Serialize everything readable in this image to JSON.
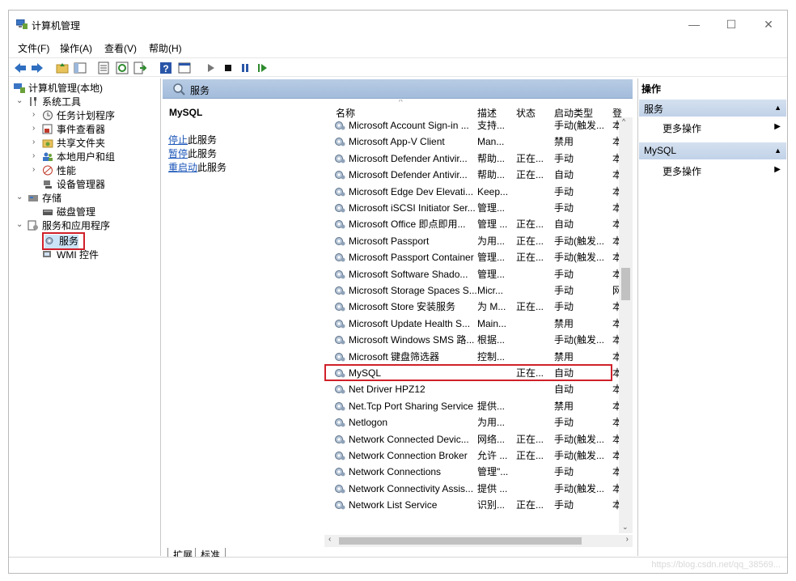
{
  "window": {
    "title": "计算机管理",
    "controls": {
      "minimize": "—",
      "maximize": "☐",
      "close": "✕"
    }
  },
  "menubar": {
    "items": [
      "文件(F)",
      "操作(A)",
      "查看(V)",
      "帮助(H)"
    ]
  },
  "toolbar": {
    "icons": [
      "back-icon",
      "forward-icon",
      "folder-up-icon",
      "show-tree-icon",
      "properties-icon",
      "refresh-icon",
      "export-icon",
      "help-icon",
      "console-icon",
      "play-icon",
      "stop-icon",
      "pause-icon",
      "resume-icon"
    ]
  },
  "tree": {
    "root": "计算机管理(本地)",
    "system_tools": "系统工具",
    "task_scheduler": "任务计划程序",
    "event_viewer": "事件查看器",
    "shared_folders": "共享文件夹",
    "local_users": "本地用户和组",
    "performance": "性能",
    "device_manager": "设备管理器",
    "storage": "存储",
    "disk_mgmt": "磁盘管理",
    "services_apps": "服务和应用程序",
    "services": "服务",
    "wmi": "WMI 控件"
  },
  "center": {
    "header": "服务",
    "selected_service": "MySQL",
    "actions": [
      {
        "link": "停止",
        "rest": "此服务"
      },
      {
        "link": "暂停",
        "rest": "此服务"
      },
      {
        "link": "重启动",
        "rest": "此服务"
      }
    ],
    "columns": {
      "name": "名称",
      "desc": "描述",
      "status": "状态",
      "startup": "启动类型",
      "logon": "登"
    },
    "rows": [
      {
        "name": "Microsoft Account Sign-in ...",
        "desc": "支持...",
        "status": "",
        "startup": "手动(触发...",
        "logon": "本"
      },
      {
        "name": "Microsoft App-V Client",
        "desc": "Man...",
        "status": "",
        "startup": "禁用",
        "logon": "本"
      },
      {
        "name": "Microsoft Defender Antivir...",
        "desc": "帮助...",
        "status": "正在...",
        "startup": "手动",
        "logon": "本"
      },
      {
        "name": "Microsoft Defender Antivir...",
        "desc": "帮助...",
        "status": "正在...",
        "startup": "自动",
        "logon": "本"
      },
      {
        "name": "Microsoft Edge Dev Elevati...",
        "desc": "Keep...",
        "status": "",
        "startup": "手动",
        "logon": "本"
      },
      {
        "name": "Microsoft iSCSI Initiator Ser...",
        "desc": "管理...",
        "status": "",
        "startup": "手动",
        "logon": "本"
      },
      {
        "name": "Microsoft Office 即点即用...",
        "desc": "管理 ...",
        "status": "正在...",
        "startup": "自动",
        "logon": "本"
      },
      {
        "name": "Microsoft Passport",
        "desc": "为用...",
        "status": "正在...",
        "startup": "手动(触发...",
        "logon": "本"
      },
      {
        "name": "Microsoft Passport Container",
        "desc": "管理...",
        "status": "正在...",
        "startup": "手动(触发...",
        "logon": "本"
      },
      {
        "name": "Microsoft Software Shado...",
        "desc": "管理...",
        "status": "",
        "startup": "手动",
        "logon": "本"
      },
      {
        "name": "Microsoft Storage Spaces S...",
        "desc": "Micr...",
        "status": "",
        "startup": "手动",
        "logon": "网"
      },
      {
        "name": "Microsoft Store 安装服务",
        "desc": "为 M...",
        "status": "正在...",
        "startup": "手动",
        "logon": "本"
      },
      {
        "name": "Microsoft Update Health S...",
        "desc": "Main...",
        "status": "",
        "startup": "禁用",
        "logon": "本"
      },
      {
        "name": "Microsoft Windows SMS 路...",
        "desc": "根据...",
        "status": "",
        "startup": "手动(触发...",
        "logon": "本"
      },
      {
        "name": "Microsoft 键盘筛选器",
        "desc": "控制...",
        "status": "",
        "startup": "禁用",
        "logon": "本"
      },
      {
        "name": "MySQL",
        "desc": "",
        "status": "正在...",
        "startup": "自动",
        "logon": "本"
      },
      {
        "name": "Net Driver HPZ12",
        "desc": "",
        "status": "",
        "startup": "自动",
        "logon": "本"
      },
      {
        "name": "Net.Tcp Port Sharing Service",
        "desc": "提供...",
        "status": "",
        "startup": "禁用",
        "logon": "本"
      },
      {
        "name": "Netlogon",
        "desc": "为用...",
        "status": "",
        "startup": "手动",
        "logon": "本"
      },
      {
        "name": "Network Connected Devic...",
        "desc": "网络...",
        "status": "正在...",
        "startup": "手动(触发...",
        "logon": "本"
      },
      {
        "name": "Network Connection Broker",
        "desc": "允许 ...",
        "status": "正在...",
        "startup": "手动(触发...",
        "logon": "本"
      },
      {
        "name": "Network Connections",
        "desc": "管理\"...",
        "status": "",
        "startup": "手动",
        "logon": "本"
      },
      {
        "name": "Network Connectivity Assis...",
        "desc": "提供 ...",
        "status": "",
        "startup": "手动(触发...",
        "logon": "本"
      },
      {
        "name": "Network List Service",
        "desc": "识别...",
        "status": "正在...",
        "startup": "手动",
        "logon": "本"
      }
    ],
    "highlighted_row": "MySQL",
    "tabs": [
      "扩展",
      "标准"
    ]
  },
  "actions_pane": {
    "header": "操作",
    "sections": [
      {
        "title": "服务",
        "item": "更多操作"
      },
      {
        "title": "MySQL",
        "item": "更多操作"
      }
    ]
  },
  "watermark": "https://blog.csdn.net/qq_38569..."
}
